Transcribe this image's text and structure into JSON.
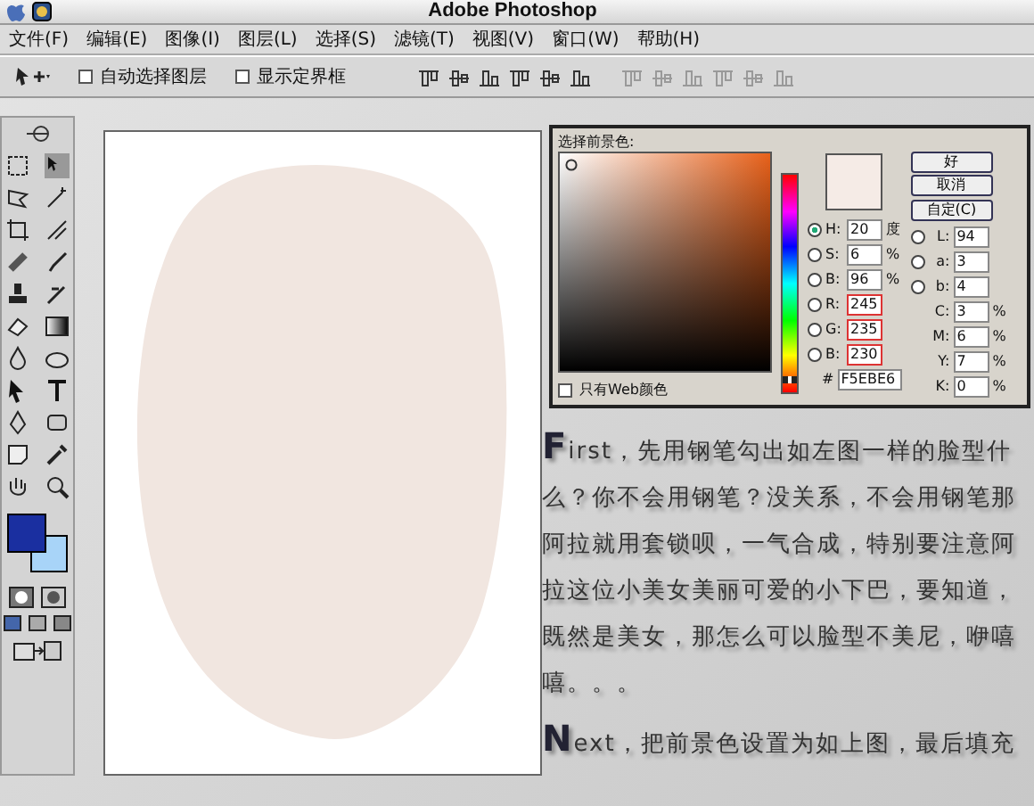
{
  "window": {
    "title": "Adobe Photoshop"
  },
  "menu": [
    "文件(F)",
    "编辑(E)",
    "图像(I)",
    "图层(L)",
    "选择(S)",
    "滤镜(T)",
    "视图(V)",
    "窗口(W)",
    "帮助(H)"
  ],
  "options_bar": {
    "checkboxes": [
      {
        "label": "自动选择图层",
        "checked": false
      },
      {
        "label": "显示定界框",
        "checked": false
      }
    ]
  },
  "color_picker": {
    "title": "选择前景色:",
    "hue_slider": {
      "level": 0.06
    },
    "buttons": [
      "好",
      "取消",
      "自定(C)"
    ],
    "fields_left": [
      {
        "label": "H:",
        "value": "20",
        "unit": "度",
        "selected": true,
        "highlighted": false
      },
      {
        "label": "S:",
        "value": "6",
        "unit": "%",
        "selected": false,
        "highlighted": false
      },
      {
        "label": "B:",
        "value": "96",
        "unit": "%",
        "selected": false,
        "highlighted": false
      },
      {
        "label": "R:",
        "value": "245",
        "selected": false,
        "highlighted": true
      },
      {
        "label": "G:",
        "value": "235",
        "selected": false,
        "highlighted": true
      },
      {
        "label": "B:",
        "value": "230",
        "selected": false,
        "highlighted": true
      }
    ],
    "fields_right": [
      {
        "kind": "radio",
        "label": "L:",
        "value": "94",
        "selected": false
      },
      {
        "kind": "radio",
        "label": "a:",
        "value": "3",
        "selected": false
      },
      {
        "kind": "radio",
        "label": "b:",
        "value": "4",
        "selected": false
      },
      {
        "kind": "plain",
        "label": "C:",
        "value": "3",
        "unit": "%"
      },
      {
        "kind": "plain",
        "label": "M:",
        "value": "6",
        "unit": "%"
      },
      {
        "kind": "plain",
        "label": "Y:",
        "value": "7",
        "unit": "%"
      },
      {
        "kind": "plain",
        "label": "K:",
        "value": "0",
        "unit": "%"
      }
    ],
    "hex_label": "#",
    "hex": "F5EBE6",
    "web_only": {
      "label": "只有Web颜色",
      "checked": false
    }
  },
  "paragraphs": [
    "First，先用钢笔勾出如左图一样的脸型什么？你不会用钢笔？没关系，不会用钢笔那阿拉就用套锁呗，一气合成，特别要注意阿拉这位小美女美丽可爱的小下巴，要知道，既然是美女，那怎么可以脸型不美尼，咿嘻嘻。。。",
    "Next，把前景色设置为如上图，最后填充"
  ]
}
